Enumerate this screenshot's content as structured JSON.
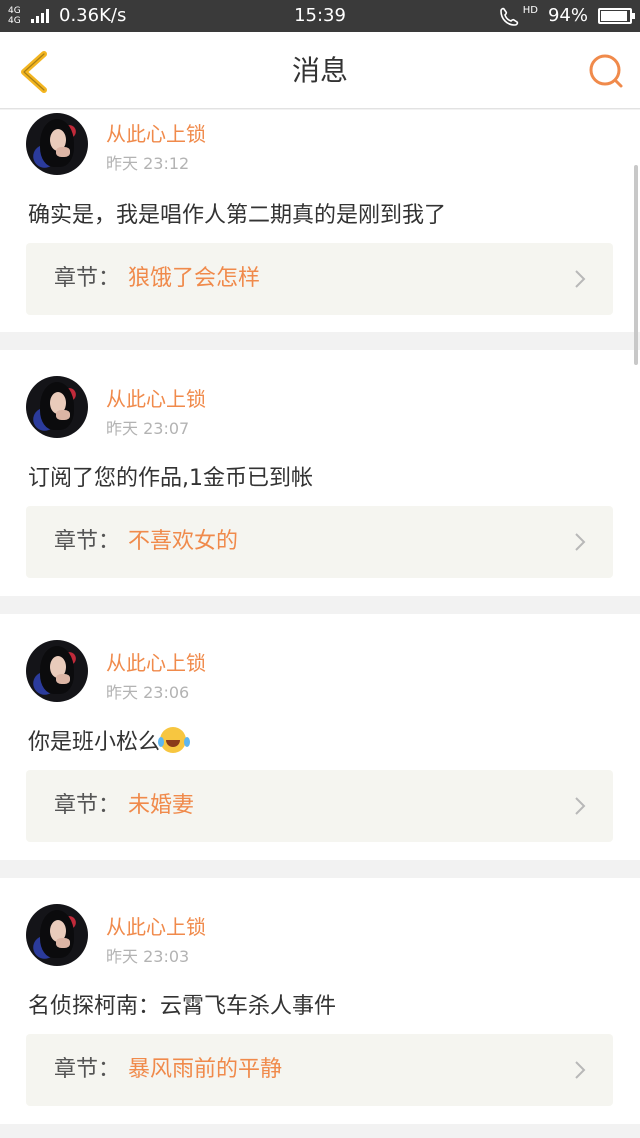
{
  "status_bar": {
    "network": "4G 4G",
    "speed": "0.36K/s",
    "time": "15:39",
    "hd_label": "HD",
    "battery": "94%",
    "battery_level": 0.94
  },
  "nav": {
    "title": "消息",
    "back_icon": "chevron-left-icon",
    "search_icon": "search-icon",
    "accent": "#f08a4b"
  },
  "messages": [
    {
      "username": "从此心上锁",
      "time": "昨天 23:12",
      "content": "确实是，我是唱作人第二期真的是刚到我了",
      "chapter_label": "章节：",
      "chapter_name": "狼饿了会怎样"
    },
    {
      "username": "从此心上锁",
      "time": "昨天 23:07",
      "content": "订阅了您的作品,1金币已到帐",
      "chapter_label": "章节：",
      "chapter_name": "不喜欢女的"
    },
    {
      "username": "从此心上锁",
      "time": "昨天 23:06",
      "content": "你是班小松么",
      "content_emoji": "face-with-tears-of-joy-emoji",
      "chapter_label": "章节：",
      "chapter_name": "未婚妻"
    },
    {
      "username": "从此心上锁",
      "time": "昨天 23:03",
      "content": "名侦探柯南：云霄飞车杀人事件",
      "chapter_label": "章节：",
      "chapter_name": "暴风雨前的平静"
    }
  ]
}
